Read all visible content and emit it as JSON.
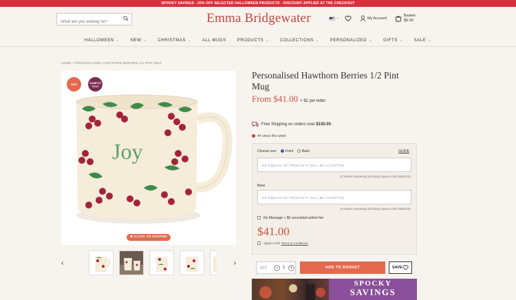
{
  "promo_bar": "SPOOKY SAVINGS - 20% OFF SELECTED HALLOWEEN PRODUCTS - DISCOUNT APPLIED AT THE CHECKOUT",
  "header": {
    "search_placeholder": "What are you looking for?",
    "logo": "Emma Bridgewater",
    "account_label": "My Account",
    "basket_label": "Basket",
    "basket_amount": "$0.00"
  },
  "nav": [
    "HALLOWEEN",
    "NEW",
    "CHRISTMAS",
    "ALL MUGS",
    "PRODUCTS",
    "COLLECTIONS",
    "PERSONALIZED",
    "GIFTS",
    "SALE"
  ],
  "nav_has_chevron": [
    true,
    true,
    true,
    false,
    true,
    true,
    true,
    true,
    true
  ],
  "breadcrumb": "HOME / PERSONALISED HAWTHORN BERRIES 1/2 PINT MUG",
  "gallery": {
    "badge_new": "NEW",
    "badge_sample": "SAMPLE TEXT",
    "mug_text": "Joy",
    "expand_label": "CLICK TO EXPAND"
  },
  "product": {
    "title": "Personalised Hawthorn Berries 1/2 Pint Mug",
    "price_from": "From $41.00",
    "price_note": "+ $2 per letter",
    "shipping_prefix": "Free Shipping on orders over ",
    "shipping_amount": "$150.00",
    "shipping_suffix": " .",
    "views": "44 views this week"
  },
  "config": {
    "choose_label": "Choose one:",
    "option_front": "Front",
    "option_back": "Back",
    "guide": "GUIDE",
    "placeholder_front": "NO EMOJIS OR PROFANITY WILL BE ACCEPTED",
    "remaining_front": "27 letters remaining including spaces (NO EMOJIS)",
    "base_label": "Base",
    "placeholder_base": "NO EMOJIS OR PROFANITY WILL BE ACCEPTED",
    "remaining_base": "16 letters remaining including spaces (NO EMOJIS)",
    "no_message": "No Message + $5 unscripted admin fee",
    "price": "$41.00",
    "terms_prefix": "Agree to the ",
    "terms_link": "Terms & Conditions"
  },
  "buy": {
    "qty_label": "QTY",
    "qty_value": "1",
    "minus": "−",
    "plus": "+",
    "add_to_basket": "ADD TO BASKET",
    "save": "SAVE"
  },
  "banner": {
    "line1": "SPOCKY",
    "line2": "SAVINGS"
  },
  "colors": {
    "promo": "#d92f3c",
    "brand": "#c8443f",
    "accent": "#e5694f",
    "sample_badge": "#7a2f50",
    "banner": "#8a4f9a"
  }
}
